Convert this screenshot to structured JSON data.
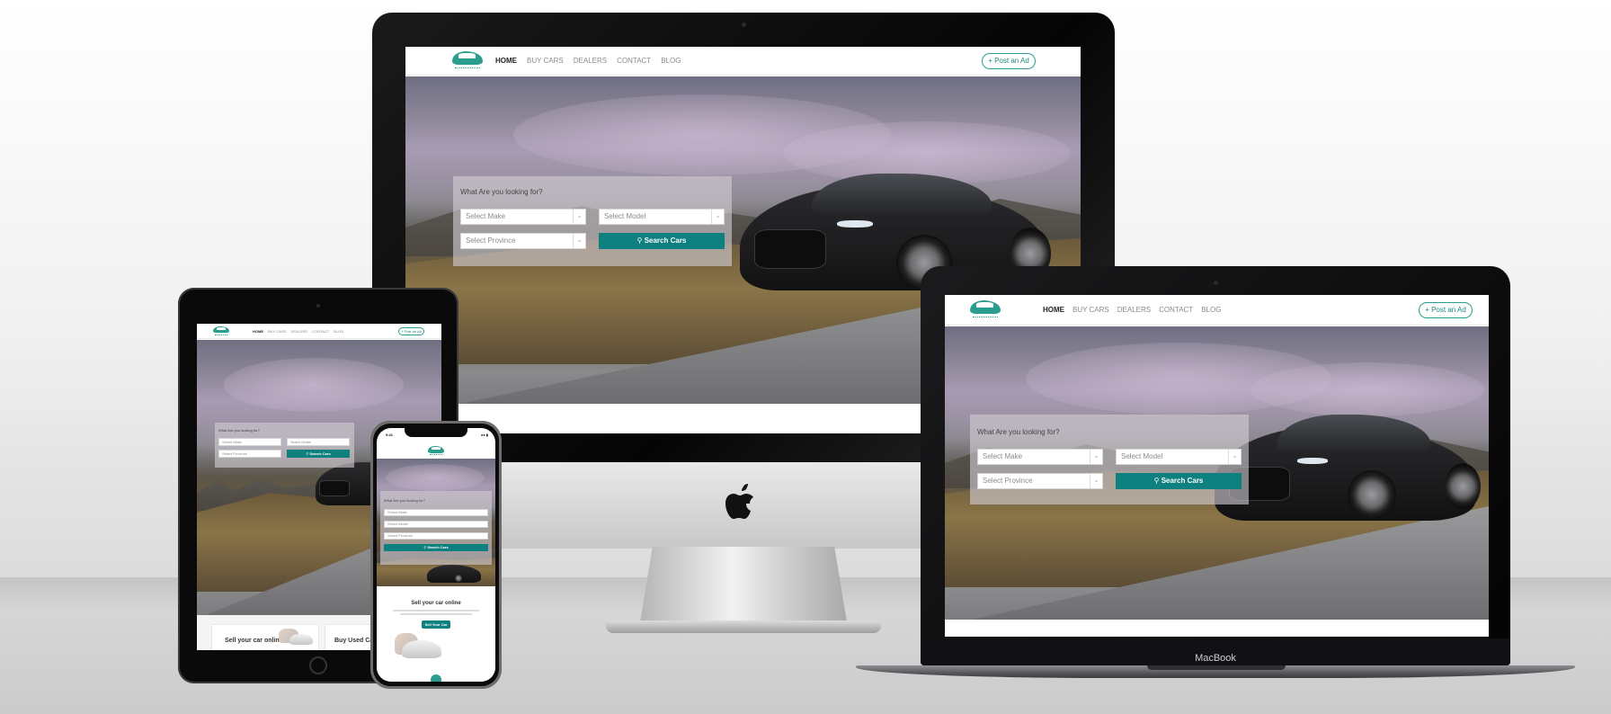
{
  "site": {
    "nav": {
      "links": [
        "HOME",
        "BUY CARS",
        "DEALERS",
        "CONTACT",
        "BLOG"
      ],
      "post_ad": "+ Post an Ad"
    },
    "search": {
      "title": "What Are you looking for?",
      "make_placeholder": "Select Make",
      "model_placeholder": "Select Model",
      "province_placeholder": "Select Province",
      "search_button": "Search Cars"
    },
    "mobile": {
      "status_time": "9:41",
      "sell_title": "Sell your car online",
      "sell_button": "Sell Your Car"
    },
    "tablet_cards": {
      "sell": "Sell your car online",
      "buy": "Buy Used Cars"
    }
  },
  "devices": {
    "laptop_label": "MacBook"
  },
  "colors": {
    "accent": "#0f8080",
    "brand_green": "#2a9d8f"
  },
  "icons": [
    "apple-logo-icon",
    "search-icon",
    "chevron-down-icon",
    "plus-icon"
  ]
}
